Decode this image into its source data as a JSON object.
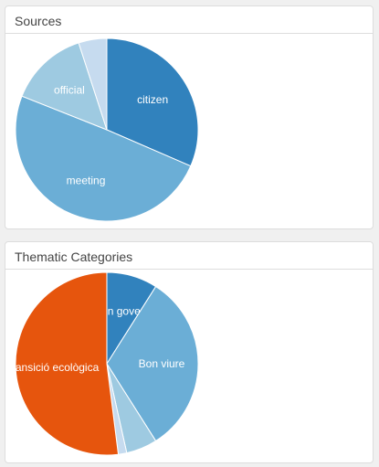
{
  "panels": [
    {
      "title": "Sources"
    },
    {
      "title": "Thematic Categories"
    }
  ],
  "chart_data": [
    {
      "type": "pie",
      "title": "Sources",
      "start_angle_deg": 0,
      "direction": "clockwise",
      "slices": [
        {
          "label": "citizen",
          "value": 31.5,
          "color": "#3182bd"
        },
        {
          "label": "meeting",
          "value": 49.5,
          "color": "#6baed6"
        },
        {
          "label": "official",
          "value": 14.0,
          "color": "#9ecae1"
        },
        {
          "label": "",
          "value": 5.0,
          "color": "#c6dbef"
        }
      ]
    },
    {
      "type": "pie",
      "title": "Thematic Categories",
      "start_angle_deg": 0,
      "direction": "clockwise",
      "slices": [
        {
          "label": "Bon govern",
          "value": 9.0,
          "color": "#3182bd"
        },
        {
          "label": "Bon viure",
          "value": 32.0,
          "color": "#6baed6"
        },
        {
          "label": "",
          "value": 5.5,
          "color": "#9ecae1"
        },
        {
          "label": "",
          "value": 1.5,
          "color": "#c6dbef"
        },
        {
          "label": "Transició ecològica",
          "value": 52.0,
          "color": "#e6550d"
        }
      ]
    }
  ]
}
